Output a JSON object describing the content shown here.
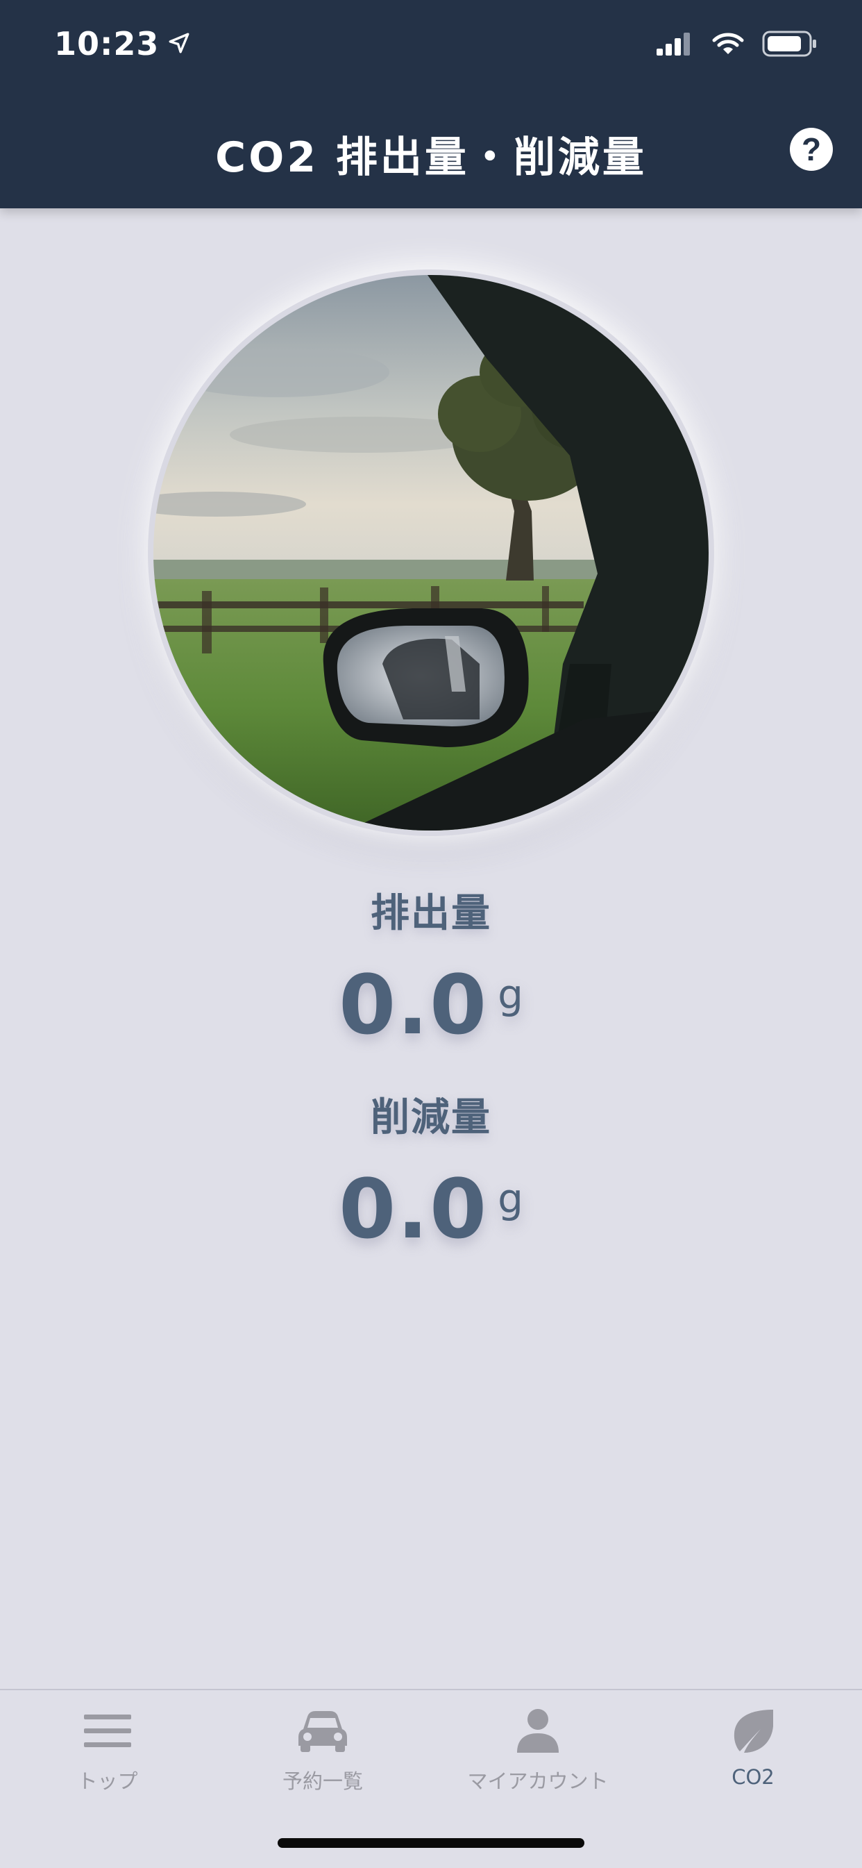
{
  "status_bar": {
    "time": "10:23"
  },
  "header": {
    "title": "CO2 排出量・削減量",
    "help_label": "?"
  },
  "emission": {
    "label": "排出量",
    "value": "0.0",
    "unit": "g"
  },
  "reduction": {
    "label": "削減量",
    "value": "0.0",
    "unit": "g"
  },
  "tabs": [
    {
      "label": "トップ",
      "icon": "menu-icon",
      "active": false
    },
    {
      "label": "予約一覧",
      "icon": "car-icon",
      "active": false
    },
    {
      "label": "マイアカウント",
      "icon": "person-icon",
      "active": false
    },
    {
      "label": "CO2",
      "icon": "leaf-icon",
      "active": true
    }
  ],
  "colors": {
    "header_bg": "#243247",
    "page_bg": "#dfdfe8",
    "value_text": "#4e627a",
    "inactive_tab": "#9a9aa2"
  }
}
